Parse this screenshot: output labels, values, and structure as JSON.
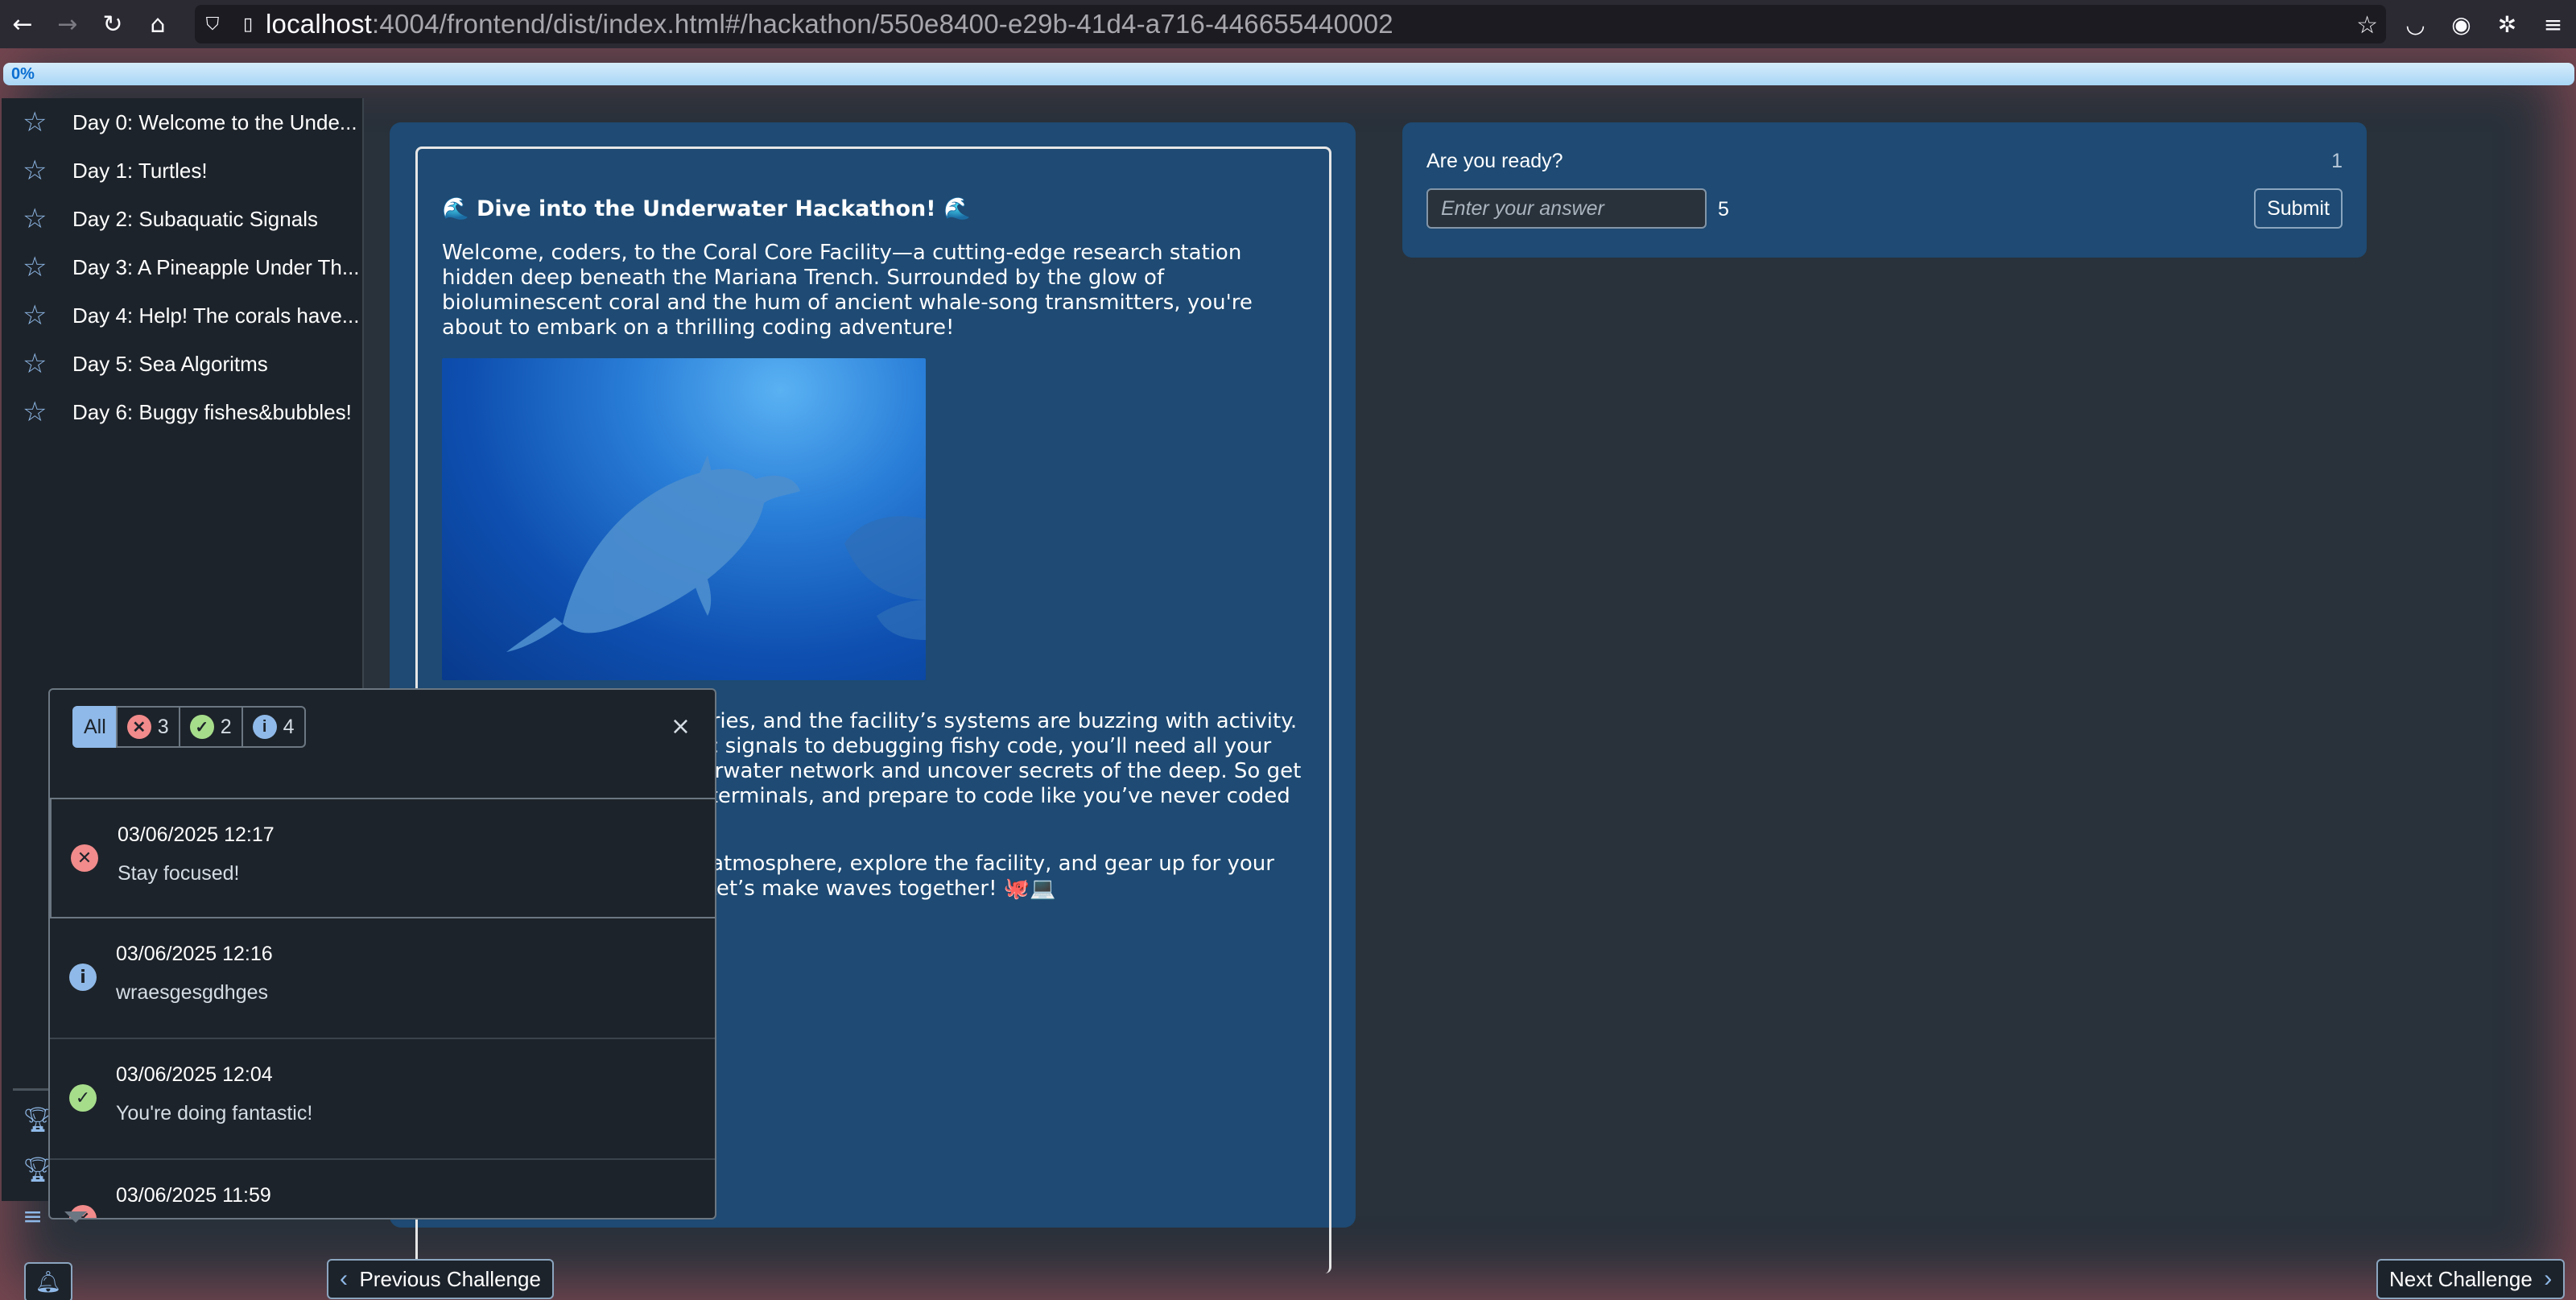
{
  "browser": {
    "url_host": "localhost",
    "url_rest": ":4004/frontend/dist/index.html#/hackathon/550e8400-e29b-41d4-a716-446655440002"
  },
  "progress": {
    "label": "0%",
    "value": 0
  },
  "sidebar": {
    "items": [
      {
        "label": "Day 0: Welcome to the Unde..."
      },
      {
        "label": "Day 1: Turtles!"
      },
      {
        "label": "Day 2: Subaquatic Signals"
      },
      {
        "label": "Day 3: A Pineapple Under Th..."
      },
      {
        "label": "Day 4: Help! The corals have..."
      },
      {
        "label": "Day 5: Sea Algoritms"
      },
      {
        "label": "Day 6: Buggy fishes&bubbles!"
      }
    ]
  },
  "content": {
    "title": "🌊 Dive into the Underwater Hackathon! 🌊",
    "paragraph1": "Welcome, coders, to the Coral Core Facility—a cutting-edge research station hidden deep beneath the Mariana Trench. Surrounded by the glow of bioluminescent coral and the hum of ancient whale-song transmitters, you're about to embark on a thrilling coding adventure!",
    "paragraph2": "The ocean is full of mysteries, and the facility’s systems are buzzing with activity. From decoding subaquatic signals to debugging fishy code, you’ll need all your skills to stabilize the underwater network and uncover secrets of the deep. So get your kit ready, sync your terminals, and prepare to code like you’ve never coded before!",
    "paragraph3": "Take today to soak in the atmosphere, explore the facility, and gear up for your first challenge on Day 1. Let’s make waves together! 🐙💻"
  },
  "question": {
    "title": "Are you ready?",
    "number": "1",
    "input_placeholder": "Enter your answer",
    "points": "5",
    "submit_label": "Submit"
  },
  "notifications": {
    "filters": {
      "all_label": "All",
      "error_count": "3",
      "success_count": "2",
      "info_count": "4"
    },
    "close_label": "×",
    "items": [
      {
        "type": "error",
        "time": "03/06/2025 12:17",
        "message": "Stay focused!"
      },
      {
        "type": "info",
        "time": "03/06/2025 12:16",
        "message": "wraesgesgdhges"
      },
      {
        "type": "success",
        "time": "03/06/2025 12:04",
        "message": "You're doing fantastic!"
      },
      {
        "type": "error",
        "time": "03/06/2025 11:59",
        "message": ""
      }
    ]
  },
  "footer": {
    "prev_label": "Previous Challenge",
    "next_label": "Next Challenge"
  },
  "colors": {
    "error": "#f28b8b",
    "success": "#a6dd8b",
    "info": "#8fb9e8",
    "card": "#1e4a73"
  }
}
